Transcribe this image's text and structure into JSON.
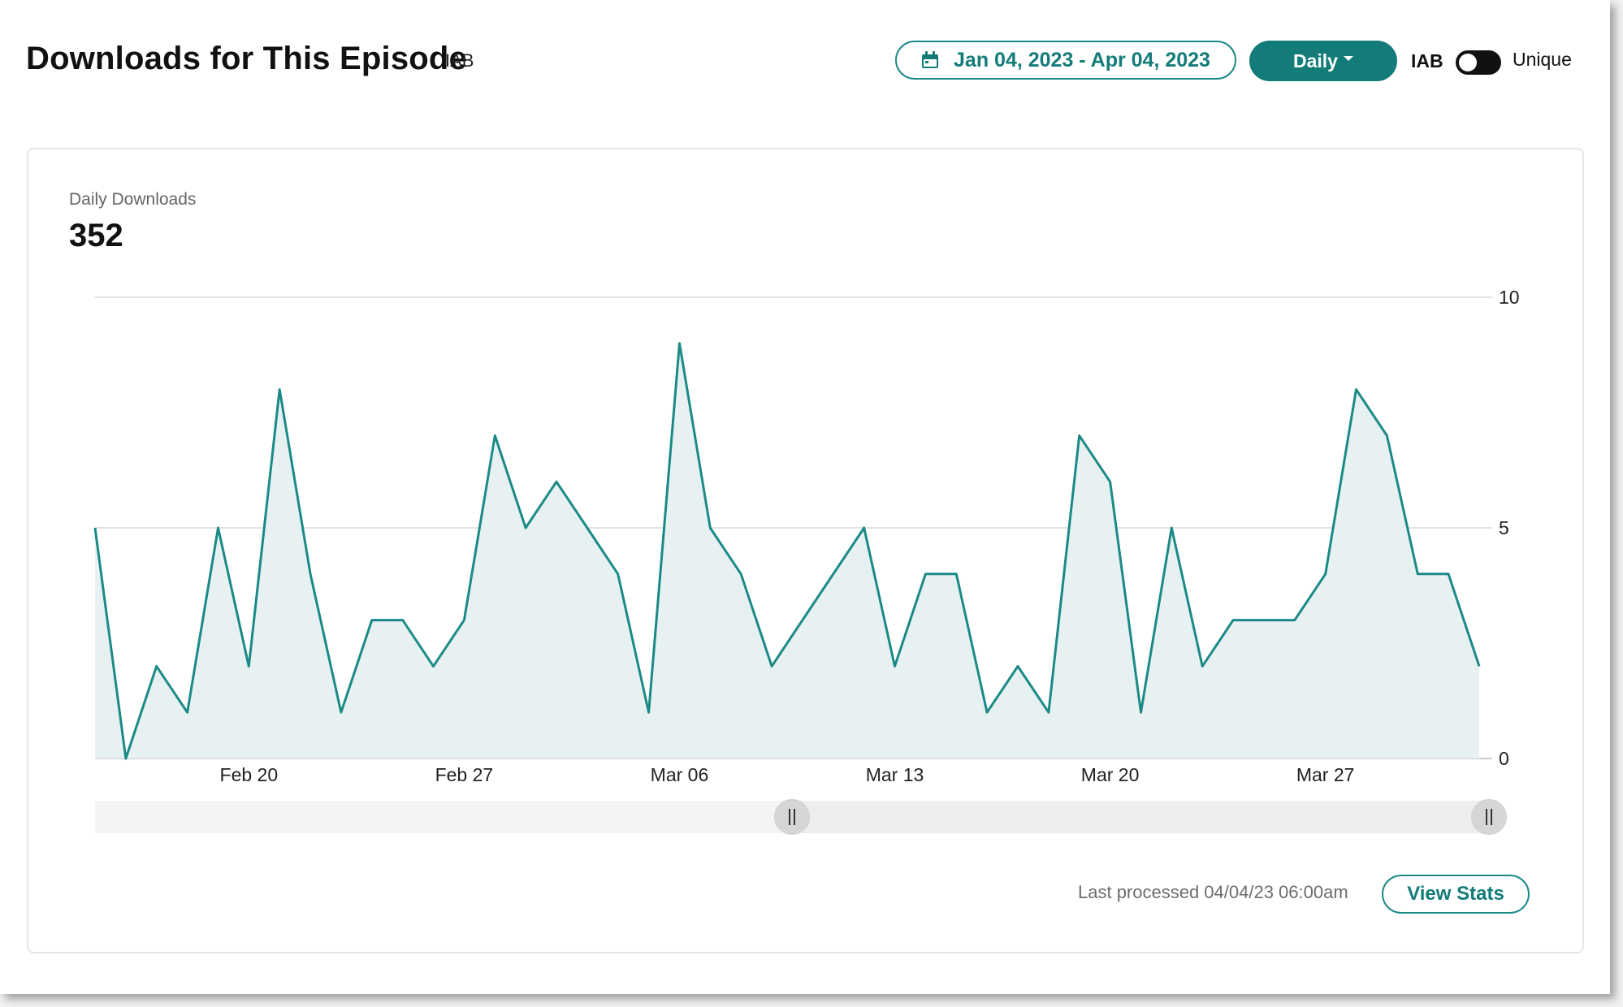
{
  "header": {
    "title": "Downloads for This Episode",
    "title_badge": "IAB",
    "date_range": "Jan 04, 2023 - Apr 04, 2023",
    "period": "Daily",
    "iab_label": "IAB",
    "unique_label": "Unique",
    "unique_toggle_on": false,
    "icons": {
      "date_range": "calendar-icon",
      "period": "caret-down-icon"
    }
  },
  "card": {
    "metric_label": "Daily Downloads",
    "metric_value": "352",
    "last_processed": "Last processed 04/04/23 06:00am",
    "view_stats_label": "View Stats",
    "range_selector": {
      "start": 0.5,
      "end": 1.0
    }
  },
  "colors": {
    "accent": "#137c79",
    "line": "#1b8a86",
    "area_fill": "#e7f1f1"
  },
  "chart_data": {
    "type": "area",
    "x_tick_labels": [
      "Feb 20",
      "Feb 27",
      "Mar 06",
      "Mar 13",
      "Mar 20",
      "Mar 27"
    ],
    "x_tick_index": [
      5,
      12,
      19,
      26,
      33,
      40
    ],
    "y_ticks": [
      0,
      5,
      10
    ],
    "ylim": [
      0,
      10
    ],
    "y_axis_side": "right",
    "grid": true,
    "series": [
      {
        "x": [
          "Feb 15",
          "Feb 16",
          "Feb 17",
          "Feb 18",
          "Feb 19",
          "Feb 20",
          "Feb 21",
          "Feb 22",
          "Feb 23",
          "Feb 24",
          "Feb 25",
          "Feb 26",
          "Feb 27",
          "Feb 28",
          "Mar 01",
          "Mar 02",
          "Mar 03",
          "Mar 04",
          "Mar 05",
          "Mar 06",
          "Mar 07",
          "Mar 08",
          "Mar 09",
          "Mar 10",
          "Mar 11",
          "Mar 12",
          "Mar 13",
          "Mar 14",
          "Mar 15",
          "Mar 16",
          "Mar 17",
          "Mar 18",
          "Mar 19",
          "Mar 20",
          "Mar 21",
          "Mar 22",
          "Mar 23",
          "Mar 24",
          "Mar 25",
          "Mar 26",
          "Mar 27",
          "Mar 28",
          "Mar 29",
          "Mar 30",
          "Mar 31",
          "Apr 01"
        ],
        "values": [
          5,
          0,
          2,
          1,
          5,
          2,
          8,
          4,
          1,
          3,
          3,
          2,
          3,
          7,
          5,
          6,
          5,
          4,
          1,
          9,
          5,
          4,
          2,
          3,
          4,
          5,
          2,
          4,
          4,
          1,
          2,
          1,
          7,
          6,
          1,
          5,
          2,
          3,
          3,
          3,
          4,
          8,
          7,
          4,
          4,
          2
        ]
      }
    ]
  }
}
